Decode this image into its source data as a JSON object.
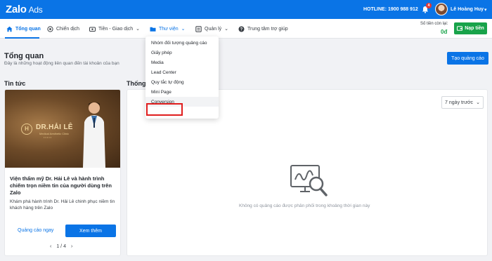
{
  "brand": {
    "logo_main": "Zalo",
    "logo_sub": "Ads"
  },
  "topbar": {
    "hotline": "HOTLINE: 1900 988 912",
    "notification_count": "4",
    "user_name": "Lê Hoàng Huy"
  },
  "nav": {
    "items": [
      {
        "label": "Tổng quan",
        "icon": "home-icon"
      },
      {
        "label": "Chiến dịch",
        "icon": "campaign-icon"
      },
      {
        "label": "Tiền - Giao dịch",
        "icon": "money-icon"
      },
      {
        "label": "Thư viện",
        "icon": "folder-icon"
      },
      {
        "label": "Quản lý",
        "icon": "manage-icon"
      },
      {
        "label": "Trung tâm trợ giúp",
        "icon": "help-icon"
      }
    ]
  },
  "balance": {
    "label": "Số tiền còn lại:",
    "value": "0đ",
    "topup_label": "Nạp tiền"
  },
  "page": {
    "title": "Tổng quan",
    "subtitle": "Đây là những hoạt động liên quan đến tài khoản của bạn",
    "create_ad_label": "Tạo quảng cáo"
  },
  "news": {
    "section_title": "Tin tức",
    "banner": {
      "monogram": "H",
      "name": "DR.HẢI LÊ",
      "tagline": "Medical Aesthetic Clinic",
      "dots": "•••••"
    },
    "title": "Viện thẩm mỹ Dr. Hải Lê và hành trình chiếm trọn niềm tin của người dùng trên Zalo",
    "description": "Khám phá hành trình Dr. Hải Lê chinh phục niềm tin khách hàng trên Zalo",
    "quick_ad_label": "Quảng cáo ngay",
    "see_more_label": "Xem thêm",
    "pager": {
      "prev": "‹",
      "text": "1 / 4",
      "next": "›"
    }
  },
  "stats": {
    "section_title": "Thống k",
    "range_label": "7 ngày trước",
    "empty_message": "Không có quảng cáo được phân phối trong khoảng thời gian này"
  },
  "library_menu": {
    "items": [
      "Nhóm đối tượng quảng cáo",
      "Giấy phép",
      "Media",
      "Lead Center",
      "Quy tắc tự động",
      "Mini Page",
      "Conversion"
    ]
  },
  "colors": {
    "primary": "#0a74e6",
    "success": "#18a34a",
    "highlight": "#e01e1e"
  }
}
